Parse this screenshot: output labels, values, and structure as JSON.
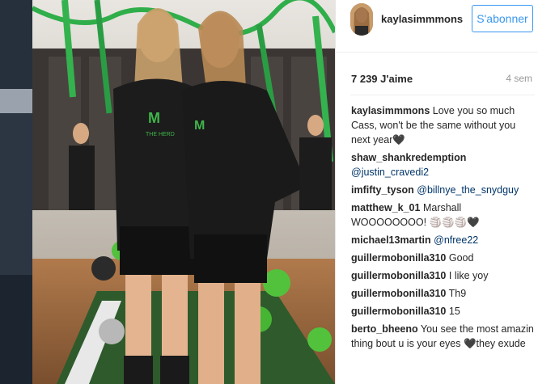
{
  "post": {
    "username": "kaylasimmmons",
    "follow_label": "S'abonner",
    "likes": "7 239 J'aime",
    "time_ago": "4 sem"
  },
  "photo": {
    "shirt_text_left": "THE HERD",
    "shirt_text_right": "M"
  },
  "comments": [
    {
      "user": "kaylasimmmons",
      "text": "Love you so much Cass, won't be the same without you next year🖤",
      "mention": ""
    },
    {
      "user": "shaw_shankredemption",
      "text": "",
      "mention": "@justin_cravedi2"
    },
    {
      "user": "imfifty_tyson",
      "text": "",
      "mention": "@billnye_the_snydguy"
    },
    {
      "user": "matthew_k_01",
      "text": "Marshall WOOOOOOOO! 🏐🏐🏐🖤",
      "mention": ""
    },
    {
      "user": "michael13martin",
      "text": "",
      "mention": "@nfree22"
    },
    {
      "user": "guillermobonilla310",
      "text": "Good",
      "mention": ""
    },
    {
      "user": "guillermobonilla310",
      "text": "I like yoy",
      "mention": ""
    },
    {
      "user": "guillermobonilla310",
      "text": "Th9",
      "mention": ""
    },
    {
      "user": "guillermobonilla310",
      "text": "15",
      "mention": ""
    },
    {
      "user": "berto_bheeno",
      "text": "You see the most amazin thing bout u is your eyes 🖤they exude",
      "mention": ""
    }
  ]
}
